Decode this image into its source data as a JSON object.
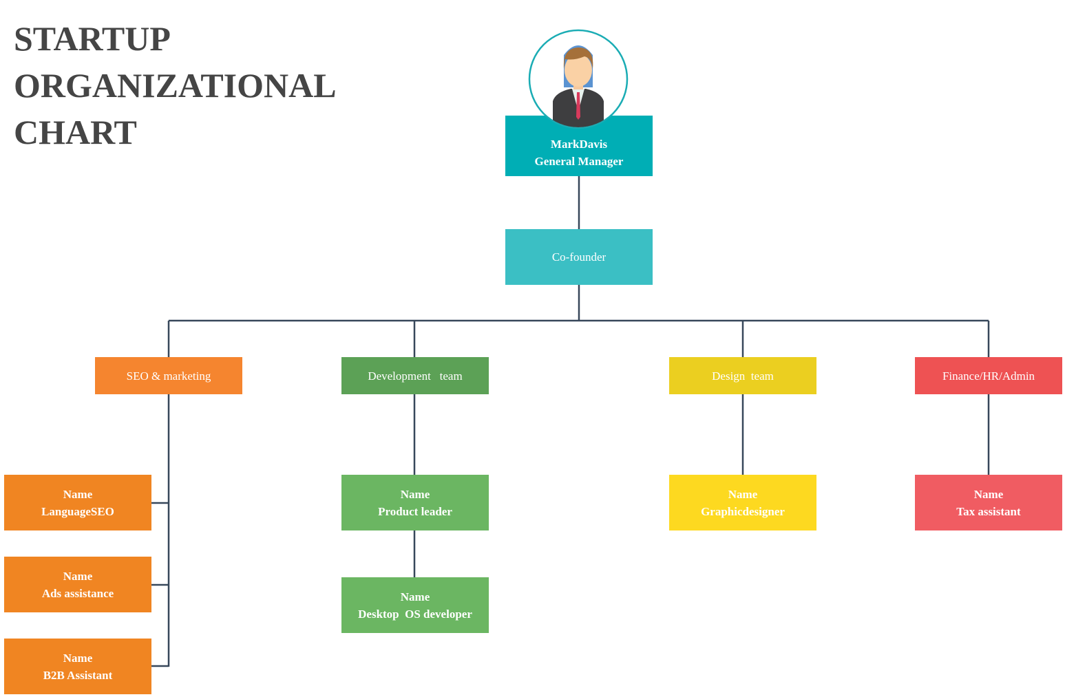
{
  "title": [
    "STARTUP",
    "ORGANIZATIONAL",
    "CHART"
  ],
  "colors": {
    "line": "#37475A",
    "gm": "#00AEB5",
    "cofounder": "#3BBFC4",
    "seo": "#F5852F",
    "seo_child": "#F08522",
    "dev": "#5CA156",
    "dev_child": "#6BB662",
    "design": "#EBCF20",
    "design_child": "#FDD920",
    "finance": "#EE5253",
    "finance_child": "#F05C62"
  },
  "avatar_icon": "businessman-avatar-icon",
  "gm": {
    "name": "MarkDavis",
    "role": "General Manager"
  },
  "cofounder": {
    "label": "Co-founder"
  },
  "departments": [
    {
      "label": "SEO & marketing",
      "members": [
        {
          "name": "Name",
          "role": "LanguageSEO"
        },
        {
          "name": "Name",
          "role": "Ads assistance"
        },
        {
          "name": "Name",
          "role": "B2B Assistant"
        }
      ]
    },
    {
      "label": "Development   team",
      "members": [
        {
          "name": "Name",
          "role": "Product leader"
        },
        {
          "name": "Name",
          "role": "Desktop  OS developer"
        }
      ]
    },
    {
      "label": "Design  team",
      "members": [
        {
          "name": "Name",
          "role": "Graphicdesigner"
        }
      ]
    },
    {
      "label": "Finance/HR/Admin",
      "members": [
        {
          "name": "Name",
          "role": "Tax assistant"
        }
      ]
    }
  ]
}
